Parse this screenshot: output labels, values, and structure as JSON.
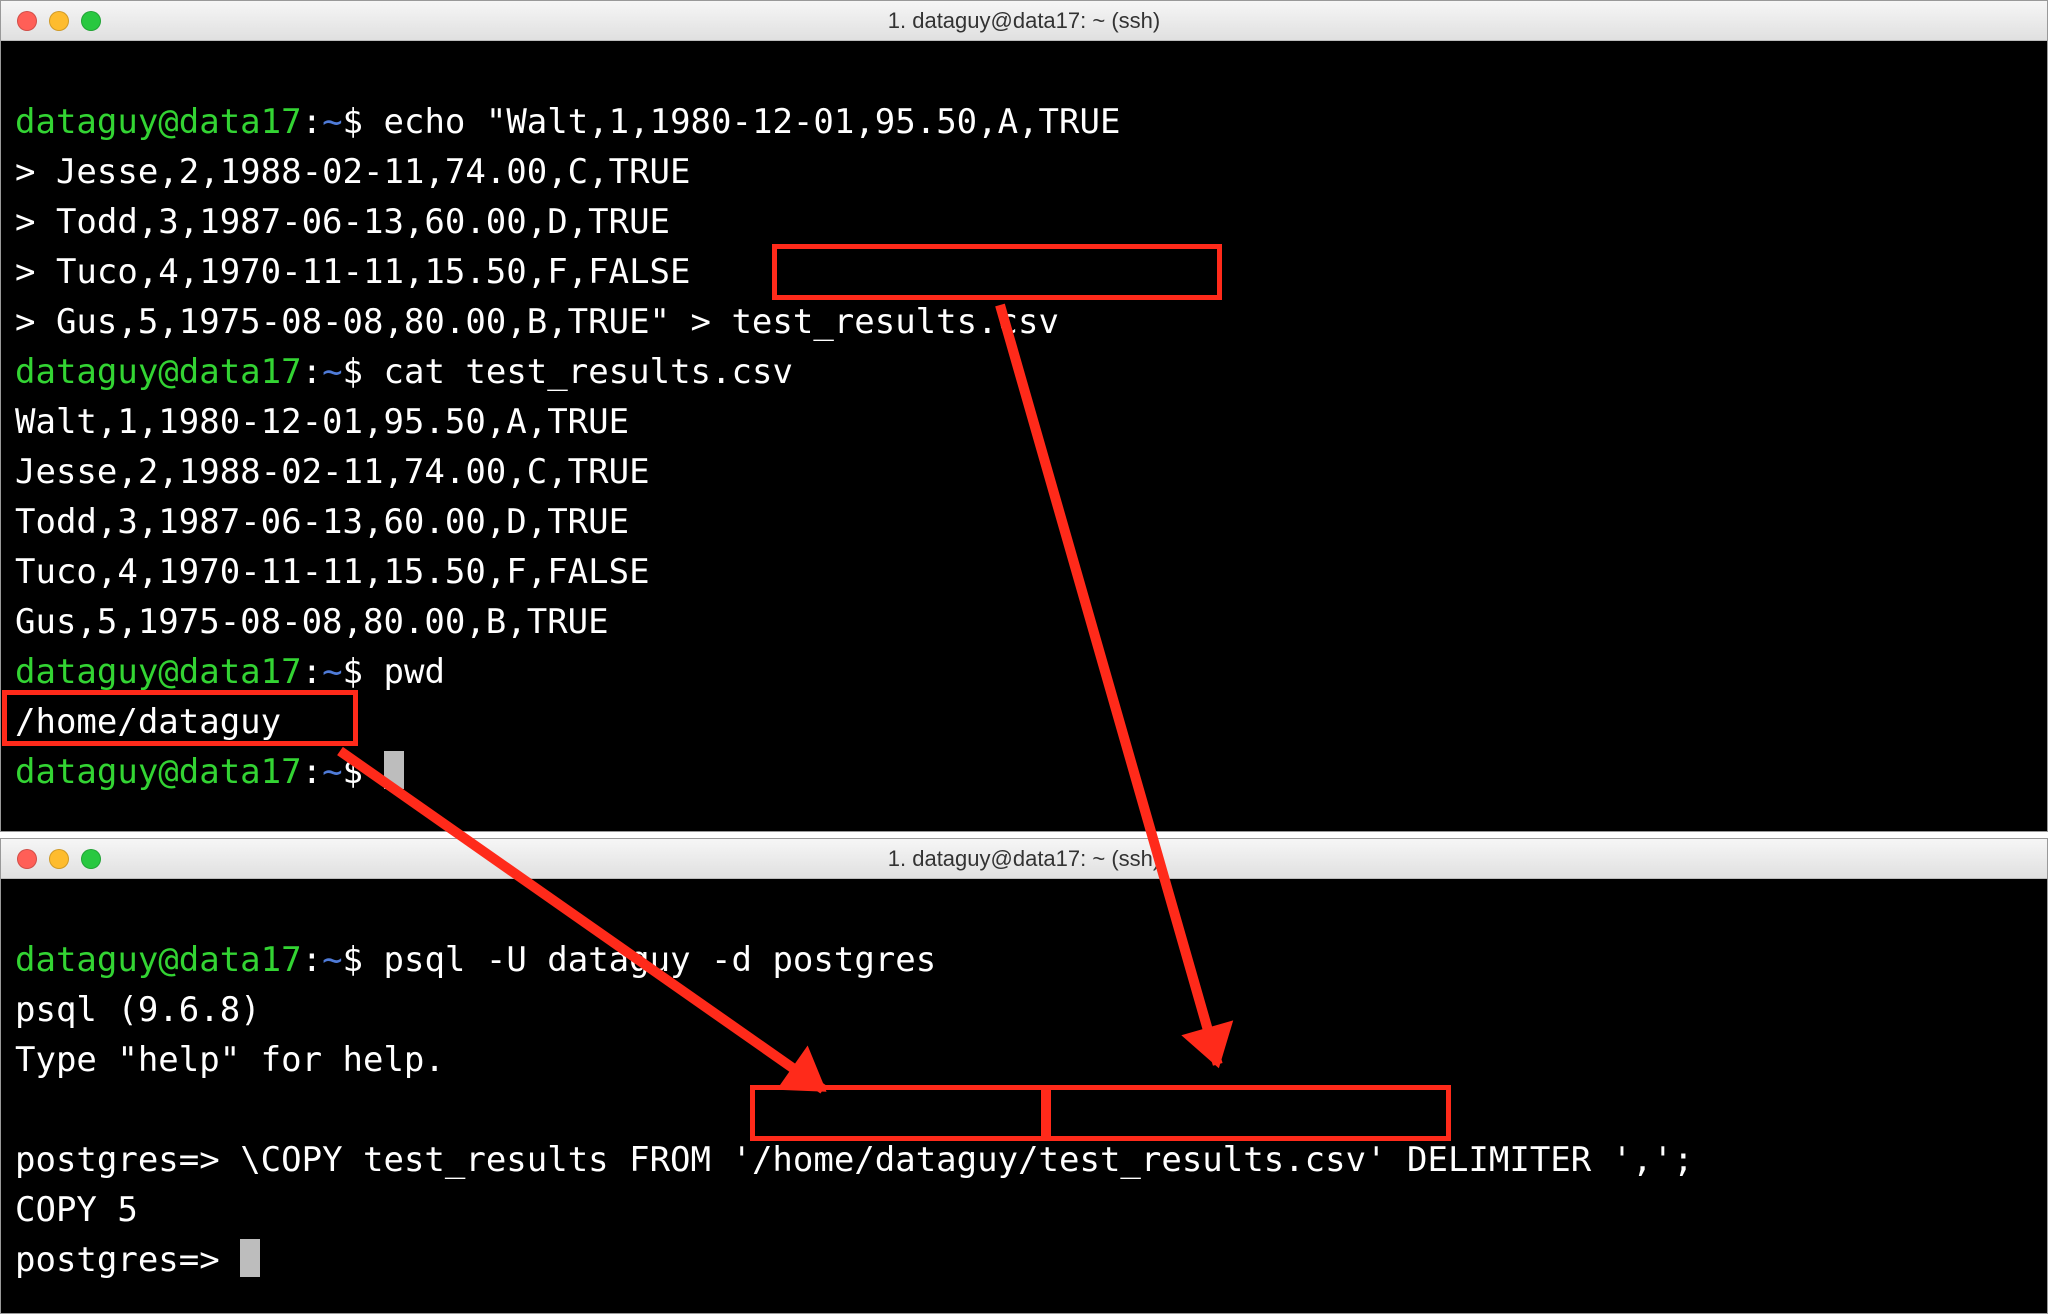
{
  "windows": {
    "top": {
      "title": "1. dataguy@data17: ~ (ssh)",
      "prompt_user": "dataguy@data17",
      "prompt_sep": ":",
      "prompt_path": "~",
      "prompt_end": "$",
      "cmd1": "echo \"Walt,1,1980-12-01,95.50,A,TRUE",
      "echo_lines": [
        "> Jesse,2,1988-02-11,74.00,C,TRUE",
        "> Todd,3,1987-06-13,60.00,D,TRUE",
        "> Tuco,4,1970-11-11,15.50,F,FALSE"
      ],
      "echo_last_prefix": "> Gus,5,1975-08-08,80.00,B,TRUE\" > ",
      "echo_last_file": "test_results.csv",
      "cmd2": "cat test_results.csv",
      "cat_output": [
        "Walt,1,1980-12-01,95.50,A,TRUE",
        "Jesse,2,1988-02-11,74.00,C,TRUE",
        "Todd,3,1987-06-13,60.00,D,TRUE",
        "Tuco,4,1970-11-11,15.50,F,FALSE",
        "Gus,5,1975-08-08,80.00,B,TRUE"
      ],
      "cmd3": "pwd",
      "pwd_output": "/home/dataguy"
    },
    "bottom": {
      "title": "1. dataguy@data17: ~ (ssh)",
      "prompt_user": "dataguy@data17",
      "prompt_sep": ":",
      "prompt_path": "~",
      "prompt_end": "$",
      "cmd1": "psql -U dataguy -d postgres",
      "psql_version": "psql (9.6.8)",
      "psql_help": "Type \"help\" for help.",
      "pg_prompt": "postgres=>",
      "copy_pre": "\\COPY test_results FROM ",
      "copy_q1": "'",
      "copy_path": "/home/dataguy/",
      "copy_file": "test_results.csv",
      "copy_q2": "'",
      "copy_post": " DELIMITER ',';",
      "copy_result": "COPY 5"
    }
  }
}
